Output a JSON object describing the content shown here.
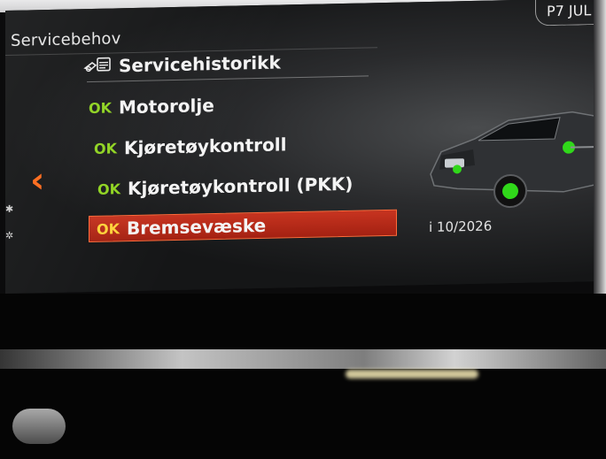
{
  "screen": {
    "title": "Servicebehov",
    "date_tab": "P7 JUL",
    "header": {
      "label": "Servicehistorikk",
      "icon": "service-history-icon"
    },
    "items": [
      {
        "status": "OK",
        "label": "Motorolje",
        "selected": false
      },
      {
        "status": "OK",
        "label": "Kjøretøykontroll",
        "selected": false
      },
      {
        "status": "OK",
        "label": "Kjøretøykontroll (PKK)",
        "selected": false
      },
      {
        "status": "OK",
        "label": "Bremsevæske",
        "selected": true
      }
    ],
    "due": "i 10/2026",
    "back_icon": "chevron-left-icon",
    "colors": {
      "ok_green": "#8fd321",
      "selection_red": "#c73420",
      "back_orange": "#ff6a1a"
    }
  }
}
